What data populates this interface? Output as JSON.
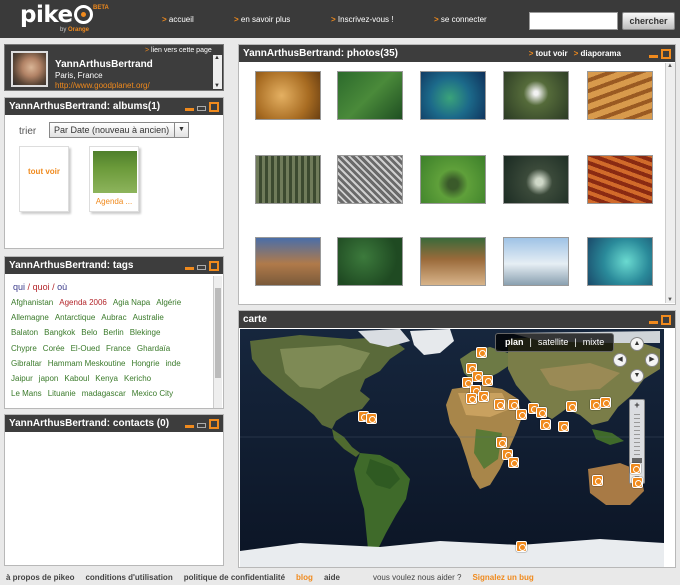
{
  "header": {
    "logo_word": "pike",
    "logo_beta": "BETA",
    "logo_by": "by",
    "logo_brand": "Orange",
    "nav": [
      "accueil",
      "en savoir plus",
      "Inscrivez-vous !",
      "se connecter"
    ],
    "search_value": "",
    "search_button": "chercher"
  },
  "profile": {
    "name": "YannArthusBertrand",
    "location": "Paris, France",
    "url": "http://www.goodplanet.org/",
    "link_label": "lien vers cette page"
  },
  "albums": {
    "title": "YannArthusBertrand: albums(1)",
    "sort_label": "trier",
    "sort_value": "Par Date (nouveau à ancien)",
    "items": [
      "tout voir",
      "Agenda ..."
    ]
  },
  "tags": {
    "title": "YannArthusBertrand: tags",
    "filter_qui1": "qui",
    "filter_quoi": "quoi",
    "filter_ou": "où",
    "sep": "/",
    "rows": [
      [
        "Afghanistan",
        "Agenda 2006",
        "Agia Napa",
        "Algérie"
      ],
      [
        "Allemagne",
        "Antarctique",
        "Aubrac",
        "Australie"
      ],
      [
        "Balaton",
        "Bangkok",
        "Belo",
        "Berlin",
        "Blekinge"
      ],
      [
        "Chypre",
        "Corée",
        "El-Oued",
        "France",
        "Ghardaïa"
      ],
      [
        "Gibraltar",
        "Hammam Meskoutine",
        "Hongrie",
        "inde"
      ],
      [
        "Jaipur",
        "japon",
        "Kaboul",
        "Kenya",
        "Kericho"
      ],
      [
        "Le Mans",
        "Lituanie",
        "madagascar",
        "Mexico City"
      ]
    ]
  },
  "contacts": {
    "title": "YannArthusBertrand: contacts (0)"
  },
  "photos": {
    "title": "YannArthusBertrand: photos(35)",
    "link_all": "tout voir",
    "link_slideshow": "diaporama"
  },
  "map": {
    "title": "carte",
    "modes": [
      "plan",
      "satellite",
      "mixte"
    ],
    "selected_mode": "plan",
    "separator": "|"
  },
  "footer": {
    "links": [
      "à propos de pikeo",
      "conditions d'utilisation",
      "politique de confidentialité",
      "blog",
      "aide"
    ],
    "help_text": "vous voulez nous aider ?",
    "bug_link": "Signalez un bug"
  },
  "colors": {
    "accent": "#f08a1d",
    "header_bg": "#3a3a3a",
    "panel_title_bg": "#3d3d3d",
    "tag_green": "#3a7a2a",
    "tag_red": "#b3262b"
  }
}
